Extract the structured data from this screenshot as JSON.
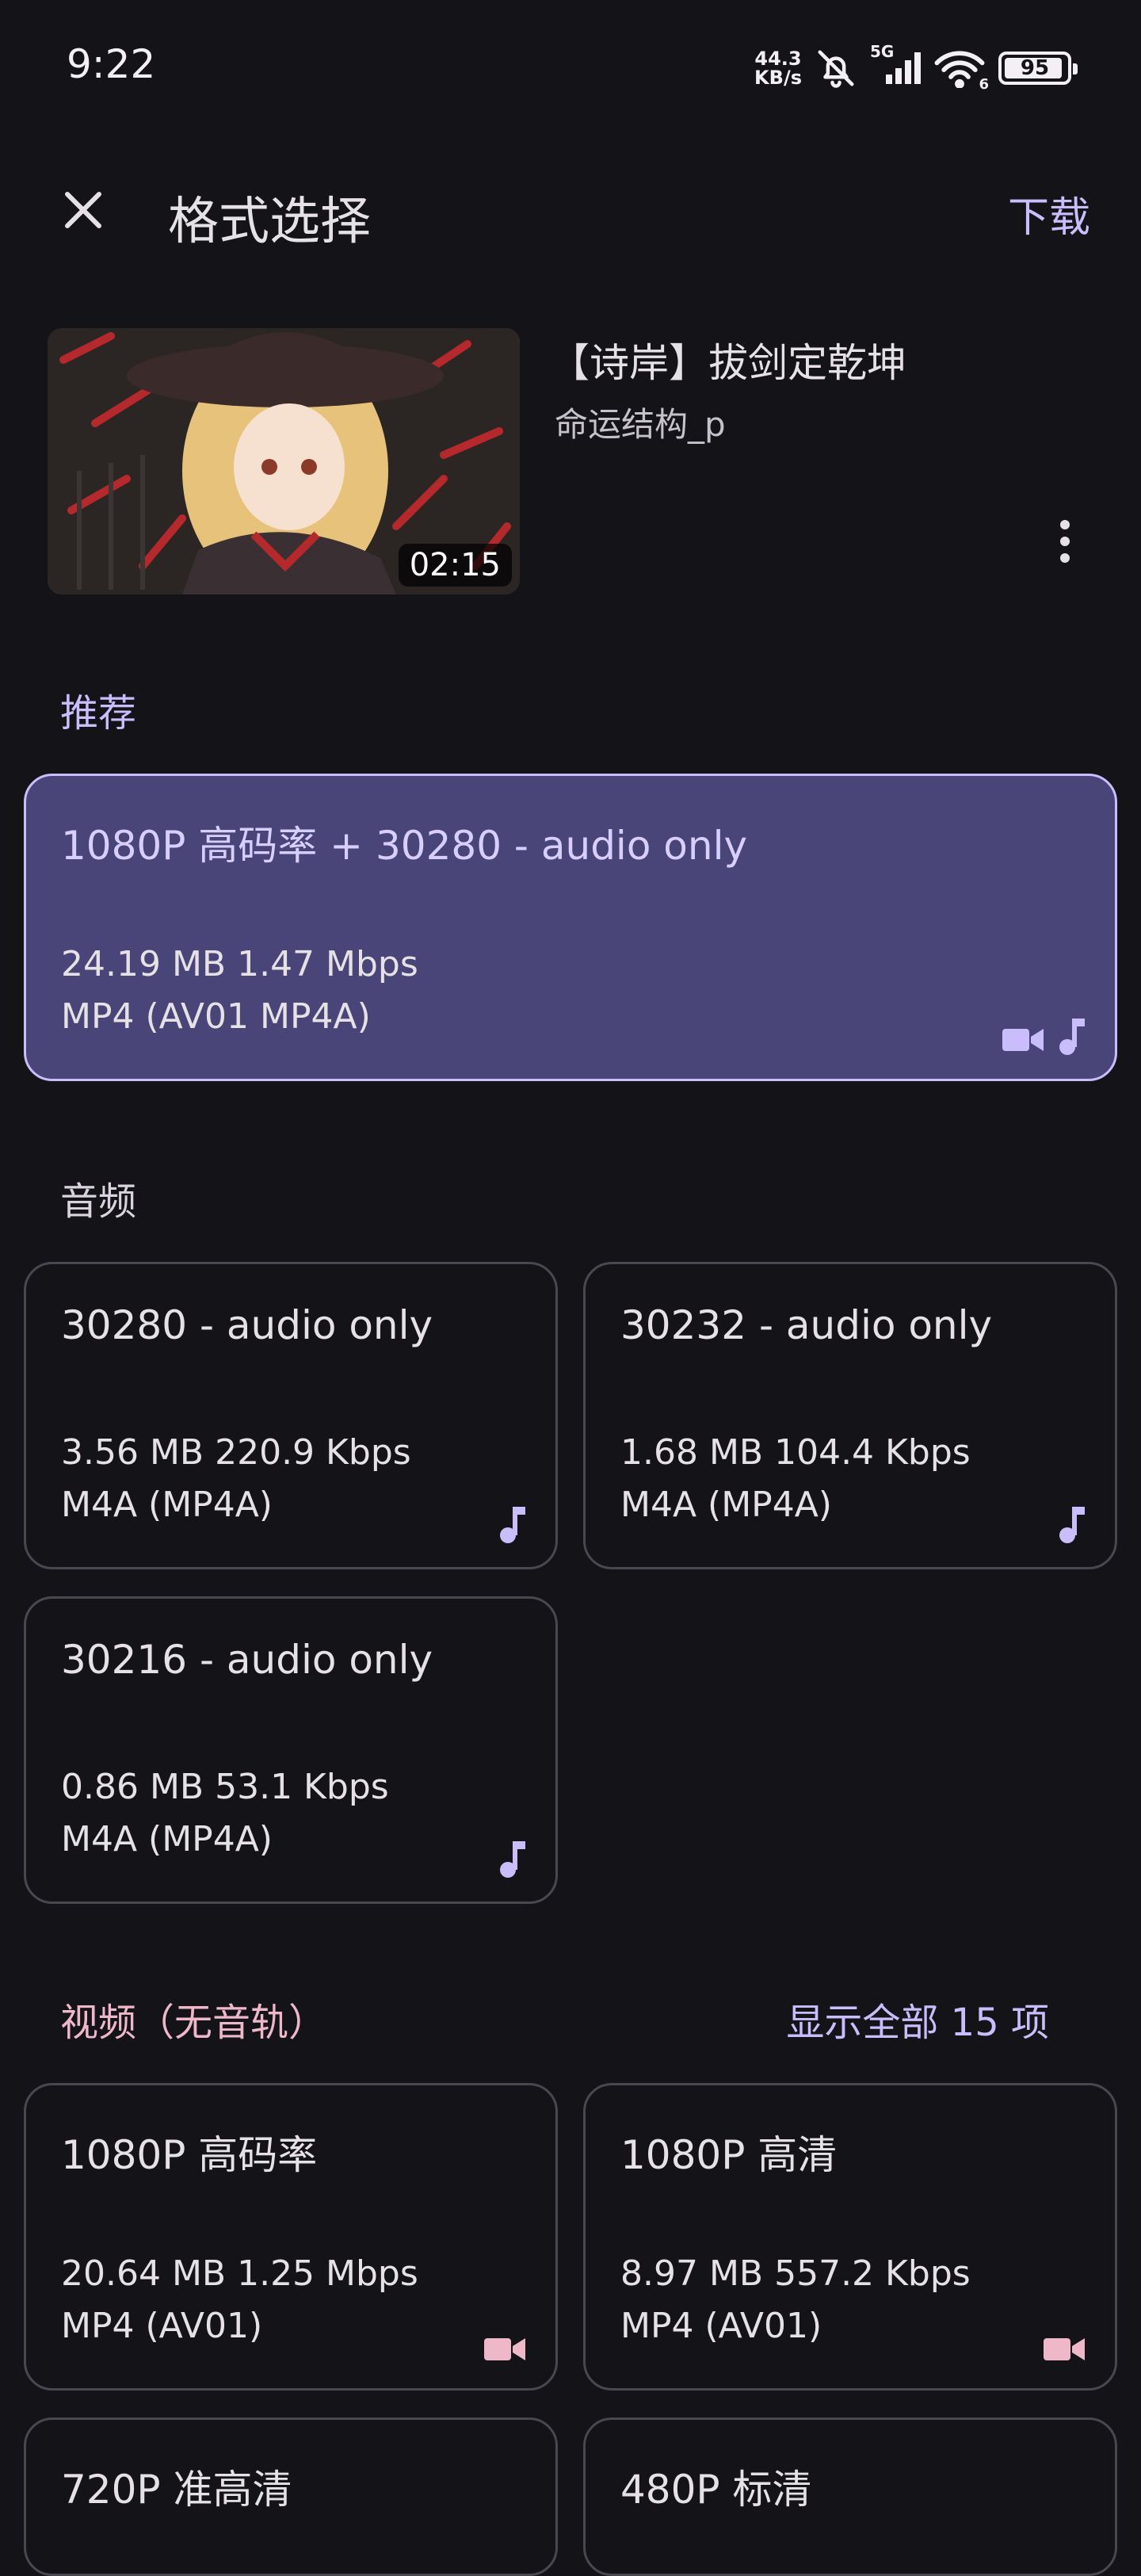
{
  "status_bar": {
    "time": "9:22",
    "net_speed_value": "44.3",
    "net_speed_unit": "KB/s",
    "network": "5G",
    "wifi_label": "6",
    "battery": "95"
  },
  "top_bar": {
    "title": "格式选择",
    "download_label": "下载",
    "icons": {
      "close": "close-icon"
    }
  },
  "video": {
    "title": "【诗岸】拔剑定乾坤",
    "uploader": "命运结构_p",
    "duration": "02:15"
  },
  "sections": {
    "recommended": "推荐",
    "audio": "音频",
    "video": "视频（无音轨）",
    "show_all": "显示全部 15 项"
  },
  "recommended": {
    "name": "1080P 高码率 + 30280 - audio only",
    "size": "24.19 MB 1.47 Mbps",
    "format": "MP4 (AV01 MP4A)"
  },
  "audio_formats": [
    {
      "name": "30280 - audio only",
      "size": "3.56 MB 220.9 Kbps",
      "format": "M4A (MP4A)"
    },
    {
      "name": "30232 - audio only",
      "size": "1.68 MB 104.4 Kbps",
      "format": "M4A (MP4A)"
    },
    {
      "name": "30216 - audio only",
      "size": "0.86 MB 53.1 Kbps",
      "format": "M4A (MP4A)"
    }
  ],
  "video_formats": [
    {
      "name": "1080P 高码率",
      "size": "20.64 MB 1.25 Mbps",
      "format": "MP4 (AV01)"
    },
    {
      "name": "1080P 高清",
      "size": "8.97 MB 557.2 Kbps",
      "format": "MP4 (AV01)"
    },
    {
      "name": "720P 准高清"
    },
    {
      "name": "480P 标清"
    }
  ],
  "colors": {
    "background": "#141318",
    "accent": "#c9bdfb",
    "selected_card": "#4a4578",
    "video_accent": "#efb8c8"
  }
}
